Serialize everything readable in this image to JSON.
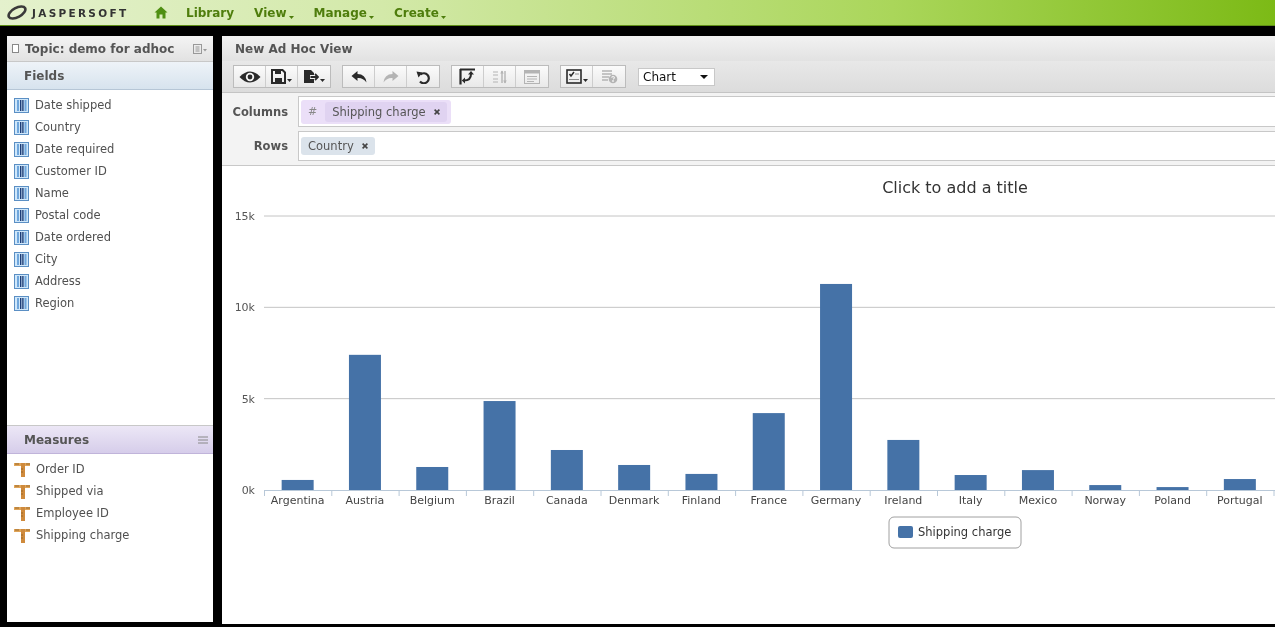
{
  "top_bar": {
    "logo": "JASPERSOFT",
    "nav": [
      {
        "label": "Library",
        "menu": false
      },
      {
        "label": "View",
        "menu": true
      },
      {
        "label": "Manage",
        "menu": true
      },
      {
        "label": "Create",
        "menu": true
      }
    ]
  },
  "topic_panel": {
    "title": "Topic: demo for adhoc",
    "sections": [
      {
        "kind": "fields",
        "title": "Fields",
        "menu": false,
        "items": [
          "Date shipped",
          "Country",
          "Date required",
          "Customer ID",
          "Name",
          "Postal code",
          "Date ordered",
          "City",
          "Address",
          "Region"
        ]
      },
      {
        "kind": "measures",
        "title": "Measures",
        "menu": true,
        "items": [
          "Order ID",
          "Shipped via",
          "Employee ID",
          "Shipping charge"
        ]
      }
    ]
  },
  "view": {
    "title": "New Ad Hoc View",
    "toolbar": {
      "groups": [
        {
          "buttons": [
            {
              "kind": "preview",
              "disabled": false,
              "dropdown": false
            },
            {
              "kind": "save",
              "disabled": false,
              "dropdown": true
            },
            {
              "kind": "export",
              "disabled": false,
              "dropdown": true
            }
          ]
        },
        {
          "buttons": [
            {
              "kind": "undo",
              "disabled": false,
              "dropdown": false
            },
            {
              "kind": "redo",
              "disabled": true,
              "dropdown": false
            },
            {
              "kind": "undo_all",
              "disabled": false,
              "dropdown": false
            }
          ]
        },
        {
          "buttons": [
            {
              "kind": "pivot",
              "disabled": false,
              "dropdown": false
            },
            {
              "kind": "sort",
              "disabled": true,
              "dropdown": false
            },
            {
              "kind": "layout",
              "disabled": true,
              "dropdown": false
            }
          ]
        },
        {
          "buttons": [
            {
              "kind": "select",
              "disabled": false,
              "dropdown": true
            },
            {
              "kind": "info",
              "disabled": true,
              "dropdown": false
            }
          ]
        }
      ],
      "view_type": "Chart"
    },
    "shelves": [
      {
        "label": "Columns",
        "pills": [
          {
            "kind": "measure",
            "prefix": "#",
            "label": "Shipping charge"
          }
        ]
      },
      {
        "label": "Rows",
        "pills": [
          {
            "kind": "field",
            "label": "Country"
          }
        ]
      }
    ],
    "chart_data": {
      "type": "bar",
      "title": "Click to add a title",
      "categories": [
        "Argentina",
        "Austria",
        "Belgium",
        "Brazil",
        "Canada",
        "Denmark",
        "Finland",
        "France",
        "Germany",
        "Ireland",
        "Italy",
        "Mexico",
        "Norway",
        "Poland",
        "Portugal"
      ],
      "series": [
        {
          "name": "Shipping charge",
          "color": "#4572a7",
          "values": [
            550,
            7400,
            1260,
            4870,
            2190,
            1370,
            880,
            4210,
            11280,
            2740,
            820,
            1090,
            270,
            160,
            600
          ]
        }
      ],
      "ylim": [
        0,
        15000
      ],
      "yticks": [
        {
          "value": 0,
          "label": "0k"
        },
        {
          "value": 5000,
          "label": "5k"
        },
        {
          "value": 10000,
          "label": "10k"
        },
        {
          "value": 15000,
          "label": "15k"
        }
      ]
    }
  }
}
